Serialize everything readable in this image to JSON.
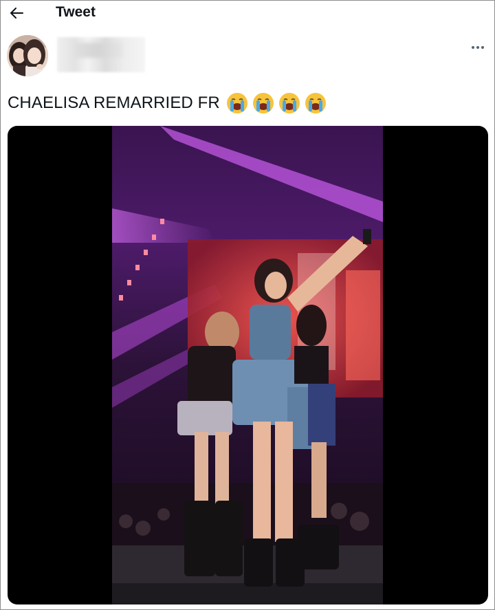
{
  "header": {
    "title": "Tweet",
    "back_icon": "arrow-left-icon"
  },
  "author": {
    "avatar_icon": "profile-photo",
    "more_icon": "more-horizontal-icon"
  },
  "tweet": {
    "text": "CHAELISA REMARRIED FR",
    "emojis": [
      "😭",
      "😭",
      "😭",
      "😭"
    ]
  },
  "media": {
    "type": "photo",
    "description_icon": "concert-stage-photo"
  },
  "colors": {
    "text": "#0f1419",
    "border": "#8c8c8c",
    "media_bg": "#000000",
    "stage_light": "#b03ccf"
  }
}
